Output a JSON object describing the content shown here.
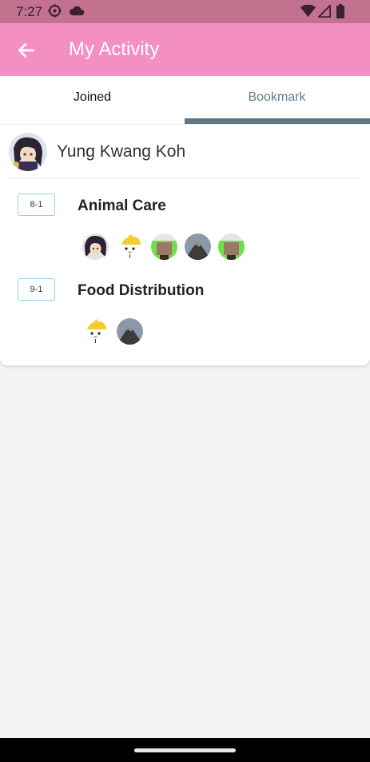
{
  "status_bar": {
    "time": "7:27",
    "icons": [
      "settings-icon",
      "cloud-icon",
      "wifi-icon",
      "signal-icon",
      "battery-icon"
    ]
  },
  "app_bar": {
    "title": "My Activity",
    "back_icon": "arrow-left-icon",
    "color": "#f48fc3"
  },
  "tabs": [
    {
      "label": "Joined",
      "selected": false
    },
    {
      "label": "Bookmark",
      "selected": true
    }
  ],
  "card": {
    "user_name": "Yung Kwang Koh",
    "activities": [
      {
        "date": "8-1",
        "name": "Animal Care",
        "participants": [
          "anime-character",
          "cartoon-chick",
          "green-block",
          "mountain",
          "green-block"
        ]
      },
      {
        "date": "9-1",
        "name": "Food Distribution",
        "participants": [
          "cartoon-chick",
          "mountain"
        ]
      }
    ]
  },
  "colors": {
    "status_bar": "#c2728f",
    "tab_indicator": "#5e7983",
    "date_badge_border": "#8fd3e8"
  }
}
